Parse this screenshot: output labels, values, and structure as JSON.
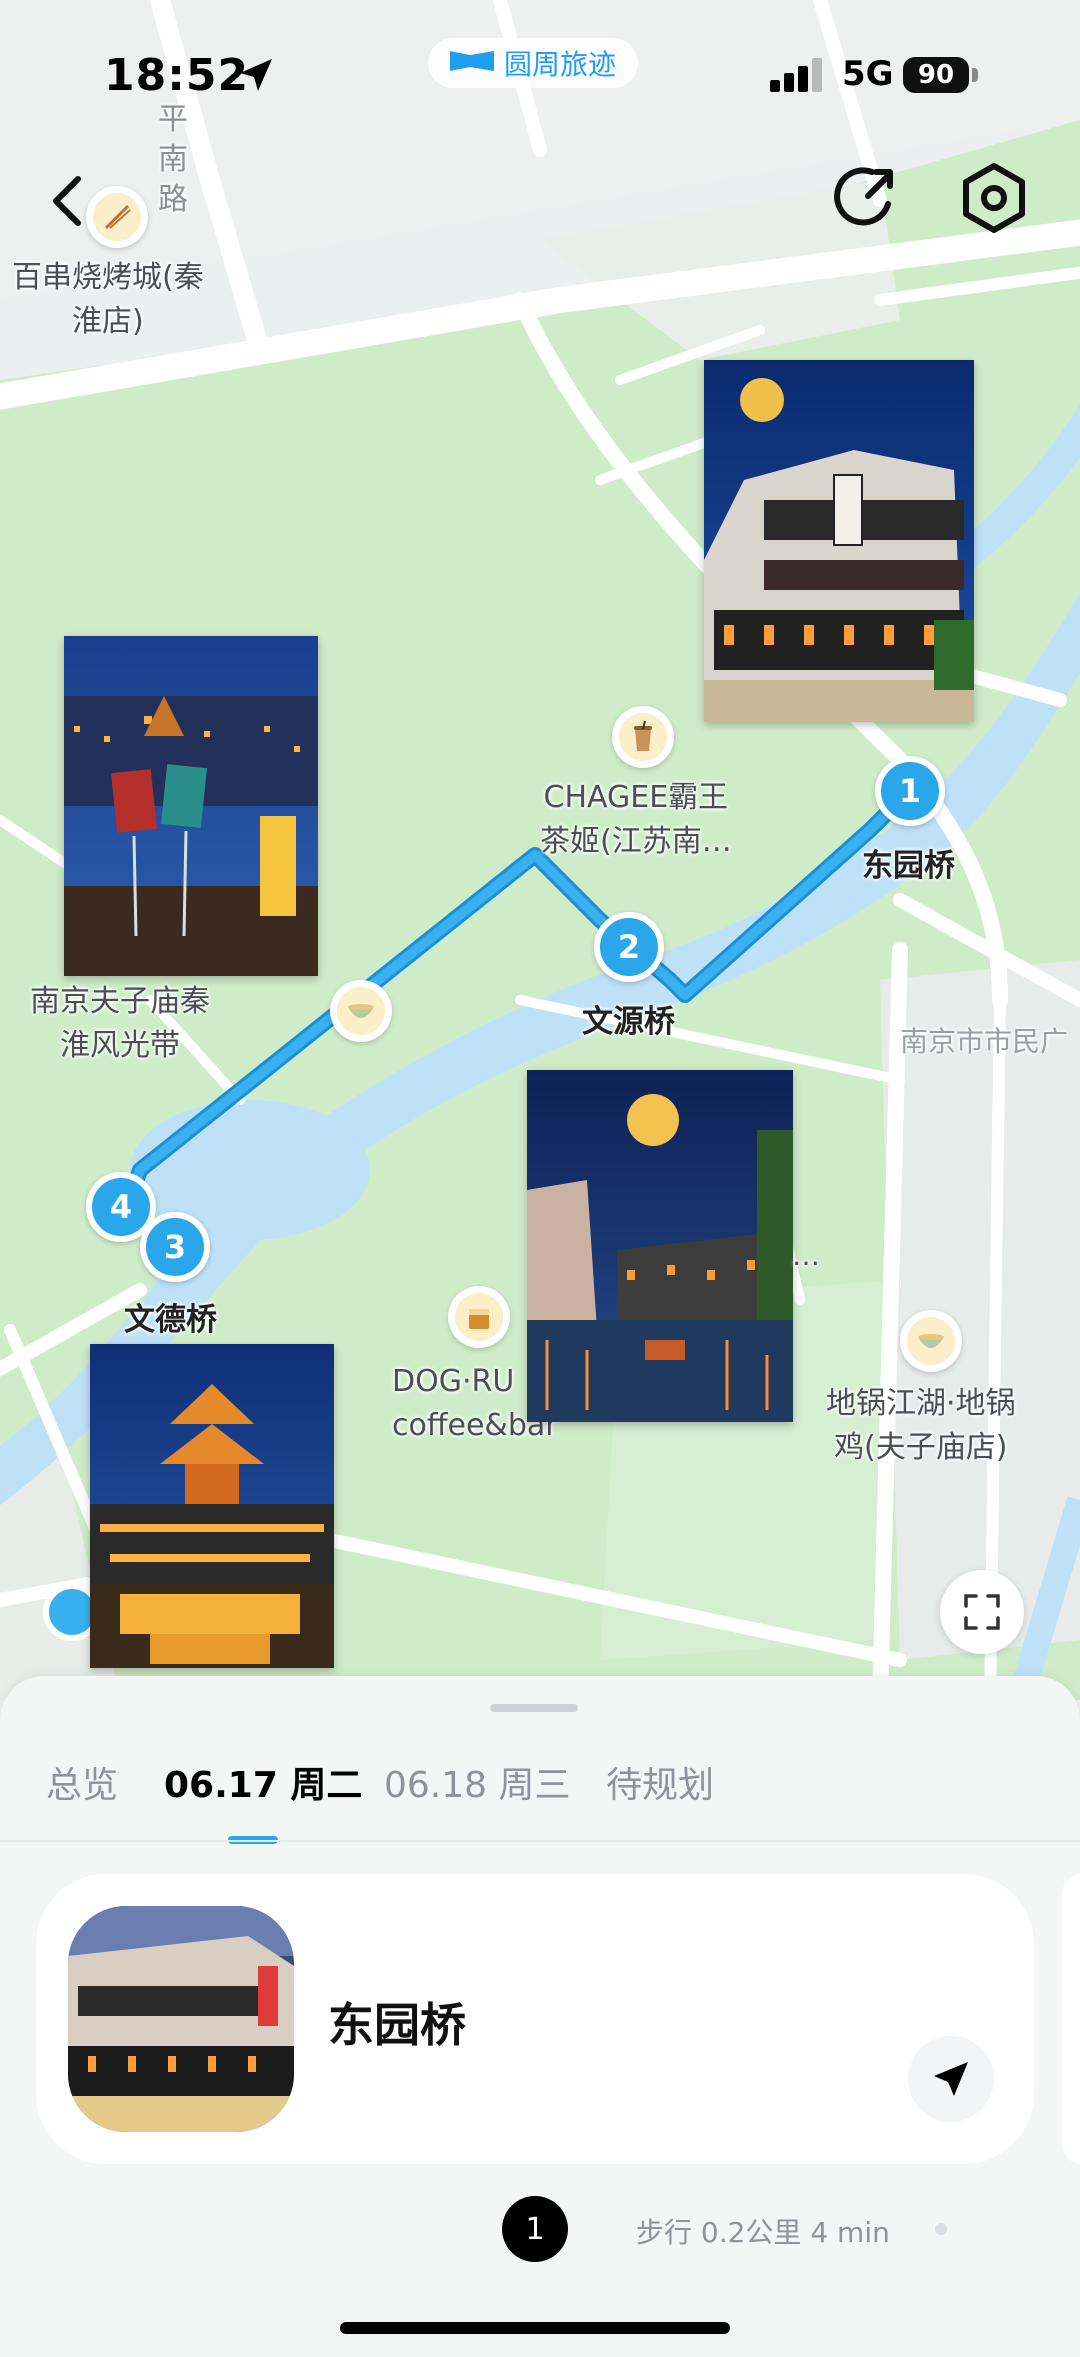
{
  "status_bar": {
    "time": "18:52",
    "app_name": "圆周旅迹",
    "network": "5G",
    "battery": "90"
  },
  "map": {
    "pois": [
      {
        "label": "百串烧烤城(秦\n淮店)",
        "icon": "skewer-icon"
      },
      {
        "label": "CHAGEE霸王\n茶姬(江苏南…",
        "icon": "milk-tea-icon"
      },
      {
        "label": "DOG·RU\ncoffee&bar",
        "icon": "whisky-glass-icon"
      },
      {
        "label": "地锅江湖·地锅\n鸡(夫子庙店)",
        "icon": "bowl-icon"
      },
      {
        "label": "南京夫子庙秦\n淮风光带",
        "icon": "bowl-icon"
      }
    ],
    "road_labels": {
      "road_left": "平\n南\n路",
      "road_right": "南京市市民广"
    },
    "stops": [
      {
        "number": "1",
        "name": "东园桥"
      },
      {
        "number": "2",
        "name": "文源桥"
      },
      {
        "number": "3",
        "name": "文德桥"
      },
      {
        "number": "4",
        "name": ""
      }
    ],
    "photo_overflow": "…"
  },
  "sheet": {
    "tabs": [
      {
        "label": "总览"
      },
      {
        "label": "06.17 周二"
      },
      {
        "label": "06.18 周三"
      },
      {
        "label": "待规划"
      }
    ],
    "active_tab": 1,
    "card": {
      "title": "东园桥"
    },
    "step": {
      "number": "1",
      "info": "步行 0.2公里 4 min"
    }
  },
  "colors": {
    "route": "#2aa6ea",
    "water": "#bfe1f7",
    "green": "#cdebc8",
    "accent": "#2aa6ea"
  }
}
